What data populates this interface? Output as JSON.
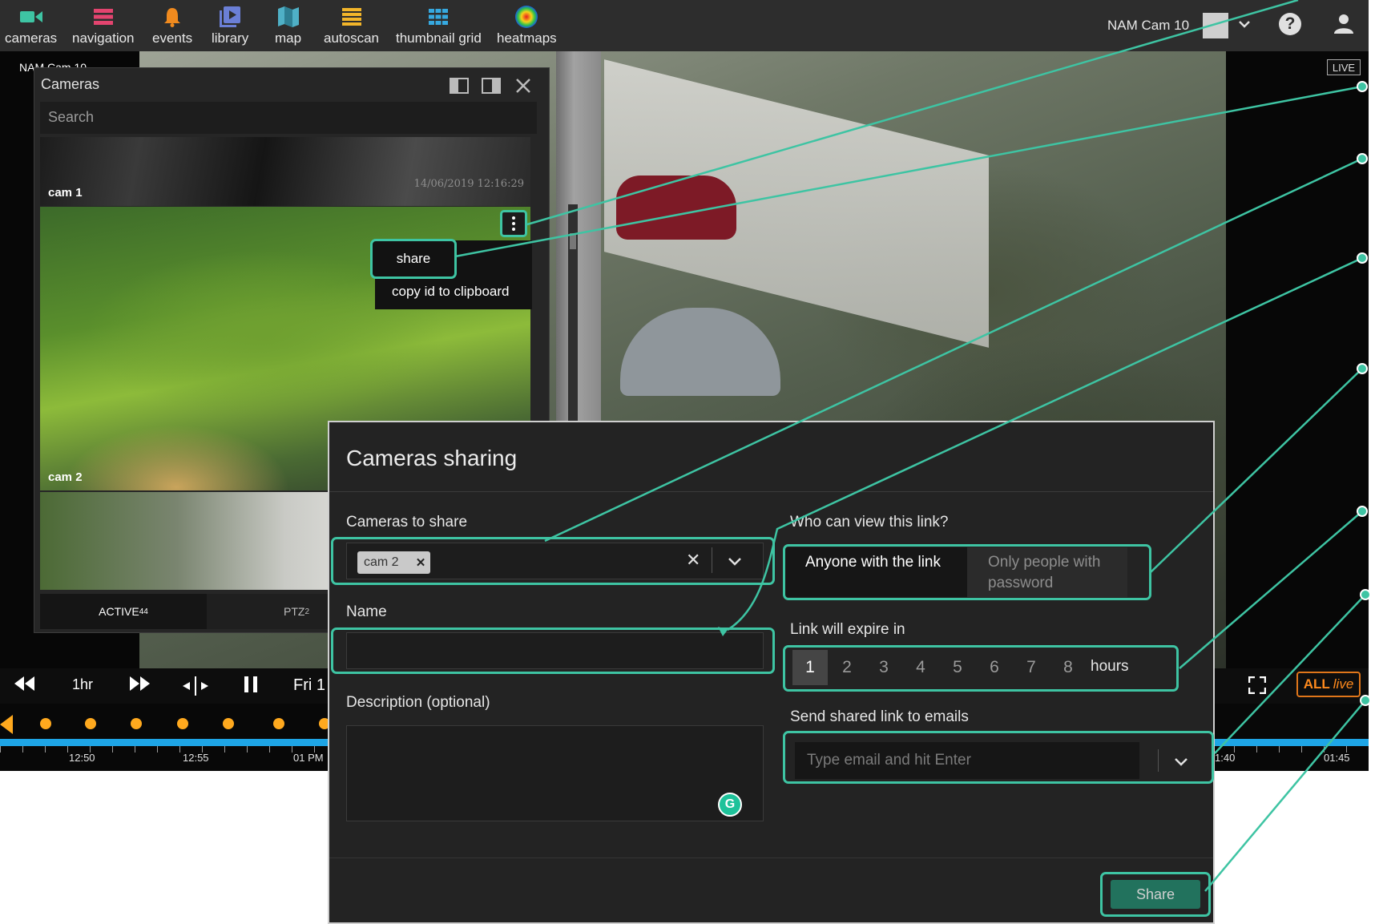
{
  "nav": {
    "items": [
      {
        "label": "cameras",
        "icon": "video-camera-icon",
        "color": "#3ec4a3"
      },
      {
        "label": "navigation",
        "icon": "list-icon",
        "color": "#e3446f"
      },
      {
        "label": "events",
        "icon": "bell-icon",
        "color": "#f08a1e"
      },
      {
        "label": "library",
        "icon": "play-library-icon",
        "color": "#6b7fd6"
      },
      {
        "label": "map",
        "icon": "map-icon",
        "color": "#4fb0c6"
      },
      {
        "label": "autoscan",
        "icon": "autoscan-icon",
        "color": "#f2b52a"
      },
      {
        "label": "thumbnail grid",
        "icon": "grid-icon",
        "color": "#36a9e0"
      },
      {
        "label": "heatmaps",
        "icon": "heatmap-icon",
        "color": "#e84b1f"
      }
    ],
    "camera_selector": "NAM Cam 10"
  },
  "viewer": {
    "live_badge": "LIVE",
    "camera_overlay": "NAM Cam 10"
  },
  "cameras_panel": {
    "title": "Cameras",
    "search_placeholder": "Search",
    "thumbnails": [
      {
        "name": "cam 1",
        "timestamp": "14/06/2019 12:16:29"
      },
      {
        "name": "cam 2"
      },
      {
        "name": ""
      }
    ],
    "context_menu": {
      "share": "share",
      "copy_id": "copy id to clipboard"
    },
    "tabs": {
      "active_label": "ACTIVE",
      "active_count": "44",
      "ptz_label": "PTZ",
      "ptz_count": "2"
    }
  },
  "playback": {
    "range": "1hr",
    "date": "Fri 1",
    "all_live_all": "ALL",
    "all_live_live": "live",
    "ticks": [
      "12:50",
      "12:55",
      "01 PM",
      "1:40",
      "01:45"
    ]
  },
  "dialog": {
    "title": "Cameras sharing",
    "cameras_label": "Cameras to share",
    "selected_camera": "cam 2",
    "name_label": "Name",
    "name_value": "",
    "description_label": "Description (optional)",
    "who_label": "Who can view this link?",
    "who_options": [
      "Anyone with the link",
      "Only people with password"
    ],
    "who_selected": "Anyone with the link",
    "expire_label": "Link will expire in",
    "hours": [
      "1",
      "2",
      "3",
      "4",
      "5",
      "6",
      "7",
      "8"
    ],
    "hours_selected": "1",
    "hours_unit": "hours",
    "emails_label": "Send shared link to emails",
    "emails_placeholder": "Type email and hit Enter",
    "share_button": "Share"
  },
  "colors": {
    "highlight": "#3ec4a3",
    "accent_orange": "#ff8a1d",
    "timeline_blue": "#1ea5e6",
    "event_dot": "#ffa91e",
    "share_button": "#22725d"
  }
}
